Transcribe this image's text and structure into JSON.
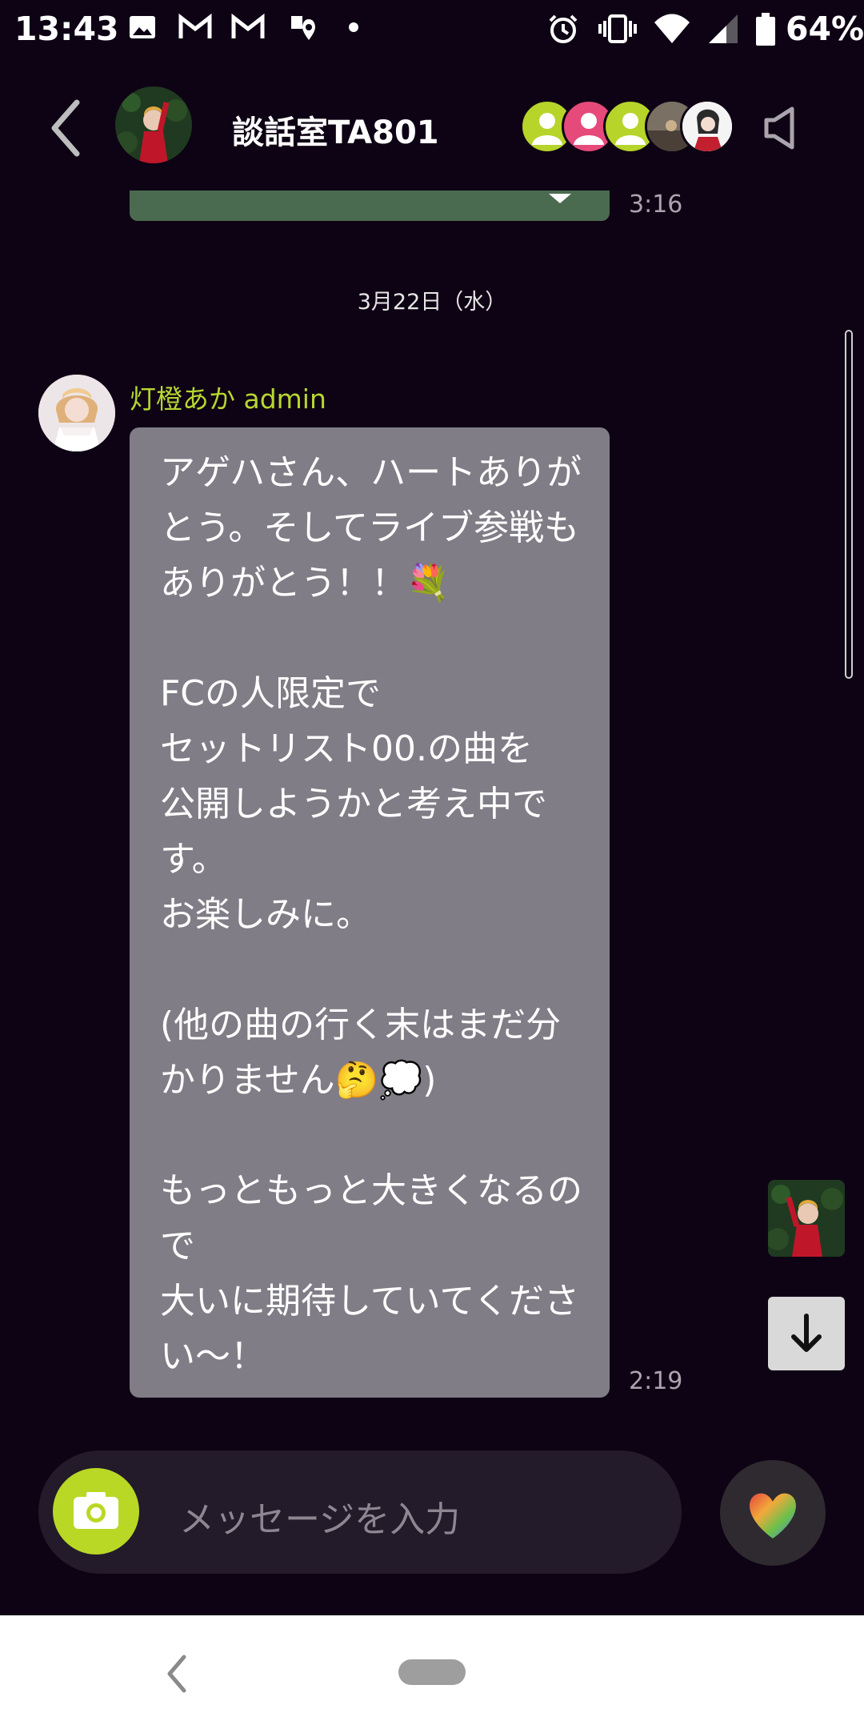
{
  "status_bar": {
    "time": "13:43",
    "battery": "64%",
    "icons": [
      "image-icon",
      "gmail-icon",
      "gmail-icon",
      "maps-icon",
      "dot-icon",
      "alarm-icon",
      "vibrate-icon",
      "wifi-icon",
      "signal-icon",
      "battery-icon"
    ]
  },
  "header": {
    "title": "談話室TA801"
  },
  "previous_message": {
    "time": "3:16"
  },
  "date_separator": "3月22日（水）",
  "message": {
    "sender": "灯橙あか admin",
    "text": "アゲハさん、ハートありがとう。そしてライブ参戦もありがとう！！💐\n\nFCの人限定で\nセットリスト00.の曲を\n公開しようかと考え中です。\nお楽しみに。\n\n(他の曲の行く末はまだ分かりません🤔💭)\n\nもっともっと大きくなるので\n大いに期待していてください〜！",
    "time": "2:19"
  },
  "input": {
    "placeholder": "メッセージを入力"
  },
  "colors": {
    "background": "#0e0314",
    "accent": "#b9d825",
    "bubble": "#807d86",
    "sender_name": "#b7d630"
  }
}
